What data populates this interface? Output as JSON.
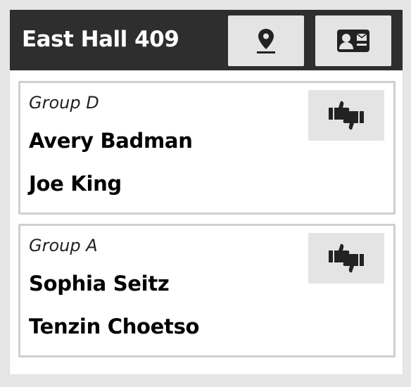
{
  "room": {
    "title": "East Hall 409"
  },
  "header_buttons": [
    {
      "icon": "map-marker-icon"
    },
    {
      "icon": "contact-card-icon"
    }
  ],
  "groups": [
    {
      "name": "Group D",
      "members": [
        "Avery Badman",
        "Joe King"
      ],
      "feedback_icon": "thumbs-up-down-icon"
    },
    {
      "name": "Group A",
      "members": [
        "Sophia Seitz",
        "Tenzin Choetso"
      ],
      "feedback_icon": "thumbs-up-down-icon"
    }
  ],
  "colors": {
    "header_bg": "#2e2e2e",
    "button_bg": "#e4e4e4",
    "border": "#cfcfcf",
    "icon": "#222222"
  }
}
